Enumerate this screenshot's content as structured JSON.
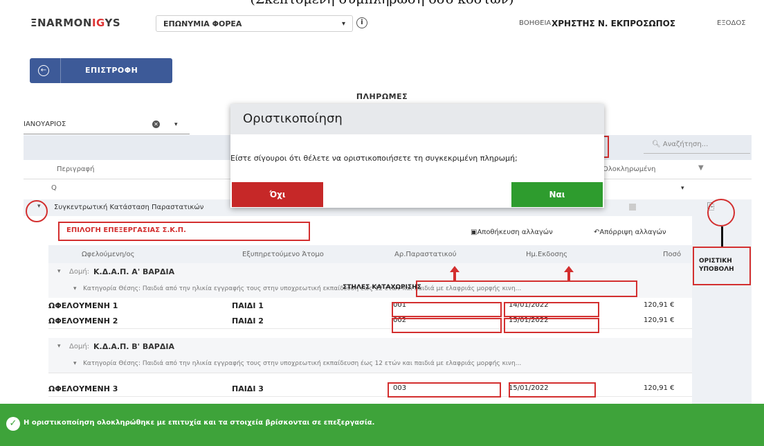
{
  "caption": "(Σκεπτομένη συμπλήρωση όσο κόστων)",
  "header": {
    "logo_prefix": "ΞNARMON",
    "logo_mid": "I",
    "logo_mid2": "G",
    "logo_suffix": "YS",
    "org_select": "ΕΠΩΝΥΜΙΑ ΦΟΡΕΑ",
    "help": "ΒΟΗΘΕΙΑ",
    "user": "ΧΡΗΣΤΗΣ Ν. ΕΚΠΡΟΣΩΠΟΣ",
    "logout": "ΕΞΟΔΟΣ"
  },
  "back_button": "ΕΠΙΣΤΡΟΦΗ",
  "page_title": "ΠΛΗΡΩΜΕΣ",
  "month_select": "ΙΑΝΟΥΑΡΙΟΣ",
  "search_placeholder": "Αναζήτηση...",
  "grid": {
    "col_description": "Περιγραφή",
    "col_completed": "Ολοκληρωμένη",
    "filter_placeholder": "Q",
    "group_row": "Συγκεντρωτική Κατάσταση Παραστατικών"
  },
  "sub_grid": {
    "save_changes": "Αποθήκευση αλλαγών",
    "discard_changes": "Απόρριψη αλλαγών",
    "headers": [
      "Ωφελούμενη/ος",
      "Εξυπηρετούμενο Άτομο",
      "Αρ.Παραστατικού",
      "Ημ.Εκδοσης",
      "Ποσό"
    ],
    "domain_label": "Δομή:",
    "domain_1": "Κ.Δ.Α.Π. Α' ΒΑΡΔΙΑ",
    "domain_2": "Κ.Δ.Α.Π. Β' ΒΑΡΔΙΑ",
    "category": "Κατηγορία Θέσης: Παιδιά από την ηλικία εγγραφής τους στην υποχρεωτική εκπαίδευση έως 12 ετών και παιδιά με ελαφριάς μορφής κινη...",
    "rows": [
      {
        "beneficiary": "ΩΦΕΛΟΥΜΕΝΗ 1",
        "person": "ΠΑΙΔΙ 1",
        "doc": "001",
        "date": "14/01/2022",
        "amount": "120,91 €"
      },
      {
        "beneficiary": "ΩΦΕΛΟΥΜΕΝΗ 2",
        "person": "ΠΑΙΔΙ 2",
        "doc": "002",
        "date": "15/01/2022",
        "amount": "120,91 €"
      },
      {
        "beneficiary": "ΩΦΕΛΟΥΜΕΝΗ 3",
        "person": "ΠΑΙΔΙ 3",
        "doc": "003",
        "date": "15/01/2022",
        "amount": "120,91 €"
      }
    ]
  },
  "annotations": {
    "edit_selection": "ΕΠΙΛΟΓΗ ΕΠΕΞΕΡΓΑΣΙΑΣ Σ.Κ.Π.",
    "entry_columns": "ΣΤΗΛΕΣ ΚΑΤΑΧΩΡΙΣΗΣ",
    "final_submit_1": "ΟΡΙΣΤΙΚΗ",
    "final_submit_2": "ΥΠΟΒΟΛΗ"
  },
  "modal": {
    "title": "Οριστικοποίηση",
    "message": "Είστε σίγουροι ότι θέλετε να οριστικοποιήσετε τη συγκεκριμένη πληρωμή;",
    "no": "Όχι",
    "yes": "Ναι"
  },
  "toast": "Η οριστικοποίηση ολοκληρώθηκε με επιτυχία και τα στοιχεία βρίσκονται σε επεξεργασία."
}
